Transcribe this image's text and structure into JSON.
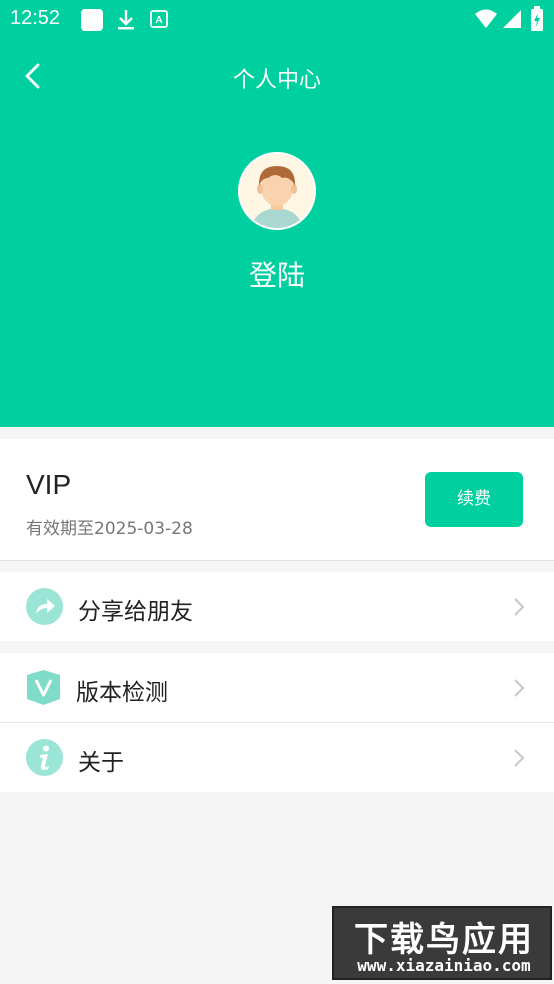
{
  "status_bar": {
    "time": "12:52",
    "icons": [
      "square-app-icon",
      "download-icon",
      "font-a-icon",
      "wifi-icon",
      "signal-icon",
      "battery-icon"
    ]
  },
  "header": {
    "title": "个人中心",
    "login_label": "登陆",
    "accent_color": "#00d0a0"
  },
  "vip": {
    "title": "VIP",
    "expiry": "有效期至2025-03-28",
    "renew_label": "续费"
  },
  "menu": {
    "items": [
      {
        "label": "分享给朋友",
        "icon": "share-icon"
      },
      {
        "label": "版本检测",
        "icon": "version-shield-icon"
      },
      {
        "label": "关于",
        "icon": "info-icon"
      }
    ]
  },
  "watermark": {
    "main": "下载鸟应用",
    "url": "www.xiazainiao.com"
  }
}
